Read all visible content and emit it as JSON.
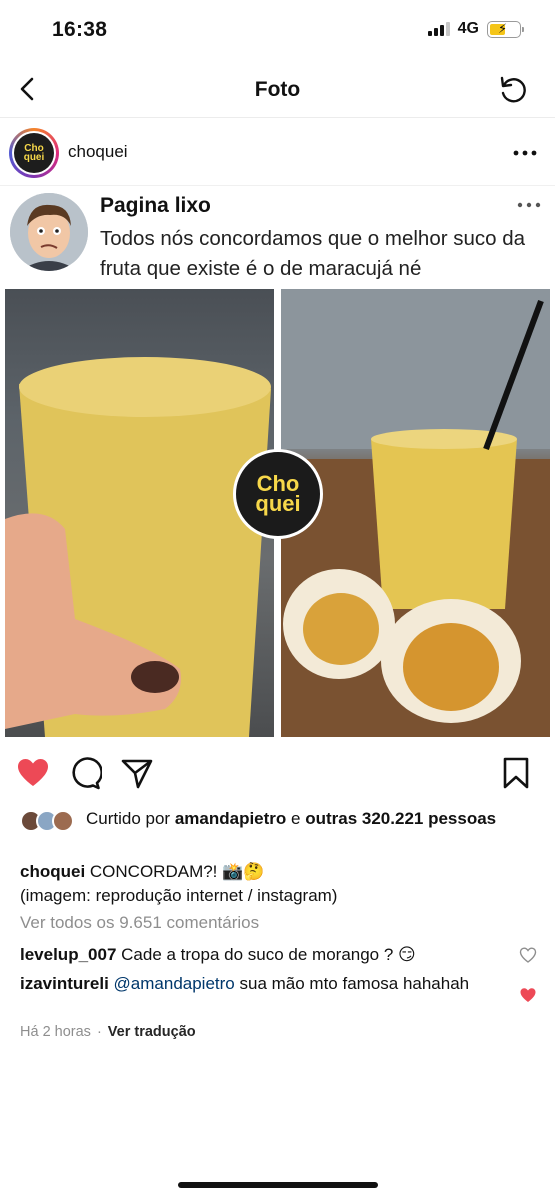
{
  "status": {
    "time": "16:38",
    "network": "4G"
  },
  "nav": {
    "title": "Foto"
  },
  "post": {
    "username": "choquei",
    "avatar_text": "Cho quei"
  },
  "tweet": {
    "name": "Pagina lixo",
    "text": "Todos nós concordamos que o melhor suco da fruta que existe é o de maracujá né"
  },
  "watermark": {
    "line1": "Cho",
    "line2": "quei"
  },
  "likes": {
    "prefix": "Curtido por ",
    "user": "amandapietro",
    "middle": " e ",
    "others": "outras 320.221 pessoas"
  },
  "caption": {
    "user": "choquei",
    "text": " CONCORDAM?! 📸🤔",
    "line2": "(imagem: reprodução internet / instagram)"
  },
  "view_all": "Ver todos os 9.651 comentários",
  "comments": [
    {
      "user": "levelup_007",
      "text": " Cade a tropa do suco de morango ? 😏",
      "liked": false
    },
    {
      "user": "izavintureli",
      "mention": " @amandapietro",
      "text": " sua mão mto famosa hahahah",
      "liked": true
    }
  ],
  "meta": {
    "time": "Há 2 horas",
    "translate": "Ver tradução"
  },
  "colors": {
    "like_red": "#ed4956",
    "mention_blue": "#00376b",
    "muted": "#8e8e8e"
  }
}
